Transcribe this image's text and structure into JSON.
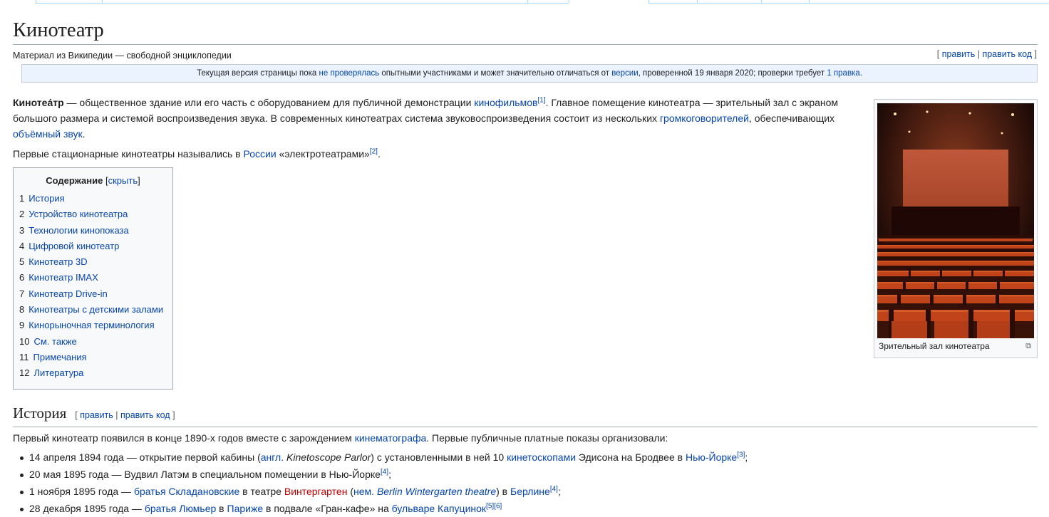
{
  "page": {
    "title": "Кинотеатр",
    "sitesub": "Материал из Википедии — свободной энциклопедии",
    "edit": "править",
    "edit_code": "править код"
  },
  "review": {
    "t1": "Текущая версия страницы пока ",
    "l1": "не проверялась",
    "t2": " опытными участниками и может значительно отличаться от ",
    "l2": "версии",
    "t3": ", проверенной 19 января 2020; проверки требует ",
    "l3": "1 правка",
    "t4": "."
  },
  "intro": {
    "term": "Кинотеа́тр",
    "t1": " — общественное здание или его часть с оборудованием для публичной демонстрации ",
    "l1": "кинофильмов",
    "r1": "[1]",
    "t2": ". Главное помещение кинотеатра — зрительный зал с экраном большого размера и системой воспроизведения звука. В современных кинотеатрах система звуковоспроизведения состоит из нескольких ",
    "l2": "громкоговорителей",
    "t3": ", обеспечивающих ",
    "l3": "объёмный звук",
    "t4": "."
  },
  "intro2": {
    "t1": "Первые стационарные кинотеатры назывались в ",
    "l1": "России",
    "t2": " «электротеатрами»",
    "r1": "[2]",
    "t3": "."
  },
  "thumb": {
    "caption": "Зрительный зал кинотеатра"
  },
  "toc": {
    "title": "Содержание",
    "hide": "скрыть",
    "items": [
      {
        "num": "1",
        "label": "История"
      },
      {
        "num": "2",
        "label": "Устройство кинотеатра"
      },
      {
        "num": "3",
        "label": "Технологии кинопоказа"
      },
      {
        "num": "4",
        "label": "Цифровой кинотеатр"
      },
      {
        "num": "5",
        "label": "Кинотеатр 3D"
      },
      {
        "num": "6",
        "label": "Кинотеатр IMAX"
      },
      {
        "num": "7",
        "label": "Кинотеатр Drive-in"
      },
      {
        "num": "8",
        "label": "Кинотеатры с детскими залами"
      },
      {
        "num": "9",
        "label": "Кинорыночная терминология"
      },
      {
        "num": "10",
        "label": "См. также"
      },
      {
        "num": "11",
        "label": "Примечания"
      },
      {
        "num": "12",
        "label": "Литература"
      }
    ]
  },
  "history": {
    "title": "История",
    "p_t1": "Первый кинотеатр появился в конце 1890-х годов вместе с зарождением ",
    "p_l1": "кинематографа",
    "p_t2": ". Первые публичные платные показы организовали:",
    "li1": {
      "t1": "14 апреля 1894 года — открытие первой кабины (",
      "l1": "англ.",
      "i1": "Kinetoscope Parlor",
      "t2": ") с установленными в ней 10 ",
      "l2": "кинетоскопами",
      "t3": " Эдисона на Бродвее в ",
      "l3": "Нью-Йорке",
      "r1": "[3]",
      "t4": ";"
    },
    "li2": {
      "t1": "20 мая 1895 года — Вудвил Латэм в специальном помещении в Нью-Йорке",
      "r1": "[4]",
      "t2": ";"
    },
    "li3": {
      "t1": "1 ноября 1895 года — ",
      "l1": "братья Складановские",
      "t2": " в театре ",
      "l2": "Винтергартен",
      "t3": " (",
      "l3": "нем.",
      "i1": "Berlin Wintergarten theatre",
      "t4": ") в ",
      "l4": "Берлине",
      "r1": "[4]",
      "t5": ";"
    },
    "li4": {
      "t1": "28 декабря 1895 года — ",
      "l1": "братья Люмьер",
      "t2": " в ",
      "l2": "Париже",
      "t3": " в подвале «Гран-кафе» на ",
      "l3": "бульваре Капуцинок",
      "r1": "[5][6]"
    }
  }
}
